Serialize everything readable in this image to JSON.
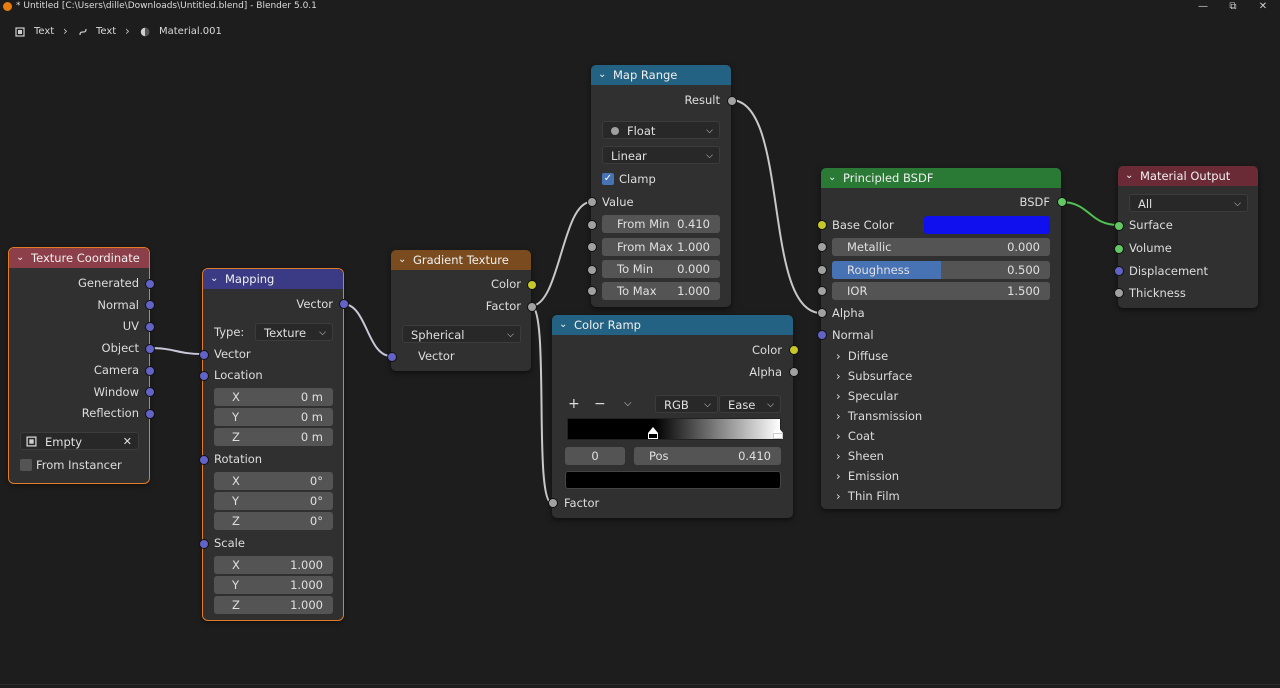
{
  "window": {
    "title": "* Untitled [C:\\Users\\dille\\Downloads\\Untitled.blend] - Blender 5.0.1"
  },
  "breadcrumb": {
    "item1": "Text",
    "item2": "Text",
    "item3": "Material.001"
  },
  "nodes": {
    "texture_coordinate": {
      "title": "Texture Coordinate",
      "outputs": [
        "Generated",
        "Normal",
        "UV",
        "Object",
        "Camera",
        "Window",
        "Reflection"
      ],
      "object_field": "Empty",
      "from_instancer": "From Instancer"
    },
    "mapping": {
      "title": "Mapping",
      "output": "Vector",
      "type_label": "Type:",
      "type_value": "Texture",
      "input_vector": "Vector",
      "location": "Location",
      "loc_x": "0 m",
      "loc_y": "0 m",
      "loc_z": "0 m",
      "rotation": "Rotation",
      "rot_x": "0°",
      "rot_y": "0°",
      "rot_z": "0°",
      "scale": "Scale",
      "scale_x": "1.000",
      "scale_y": "1.000",
      "scale_z": "1.000",
      "axis_x": "X",
      "axis_y": "Y",
      "axis_z": "Z"
    },
    "gradient_texture": {
      "title": "Gradient Texture",
      "out_color": "Color",
      "out_factor": "Factor",
      "type": "Spherical",
      "in_vector": "Vector"
    },
    "map_range": {
      "title": "Map Range",
      "out_result": "Result",
      "data_type": "Float",
      "interp": "Linear",
      "clamp": "Clamp",
      "in_value": "Value",
      "from_min_label": "From Min",
      "from_min": "0.410",
      "from_max_label": "From Max",
      "from_max": "1.000",
      "to_min_label": "To Min",
      "to_min": "0.000",
      "to_max_label": "To Max",
      "to_max": "1.000"
    },
    "color_ramp": {
      "title": "Color Ramp",
      "out_color": "Color",
      "out_alpha": "Alpha",
      "add": "+",
      "remove": "−",
      "color_mode": "RGB",
      "interpolation": "Ease",
      "stop_index": "0",
      "pos_label": "Pos",
      "pos_value": "0.410",
      "in_factor": "Factor",
      "stop_color": "#000000"
    },
    "principled": {
      "title": "Principled BSDF",
      "out_bsdf": "BSDF",
      "base_color": "Base Color",
      "base_color_value": "#1010ee",
      "metallic": "Metallic",
      "metallic_value": "0.000",
      "roughness": "Roughness",
      "roughness_value": "0.500",
      "ior": "IOR",
      "ior_value": "1.500",
      "alpha": "Alpha",
      "normal": "Normal",
      "panels": [
        "Diffuse",
        "Subsurface",
        "Specular",
        "Transmission",
        "Coat",
        "Sheen",
        "Emission",
        "Thin Film"
      ]
    },
    "material_output": {
      "title": "Material Output",
      "target": "All",
      "inputs": [
        "Surface",
        "Volume",
        "Displacement",
        "Thickness"
      ]
    }
  },
  "colors": {
    "header_input": "#8c3e49",
    "header_vector": "#3b3b85",
    "header_texture": "#7a4b1e",
    "header_converter": "#246283",
    "header_shader": "#2a7a36",
    "header_output": "#6a2b36",
    "selection": "#e27b2a"
  }
}
